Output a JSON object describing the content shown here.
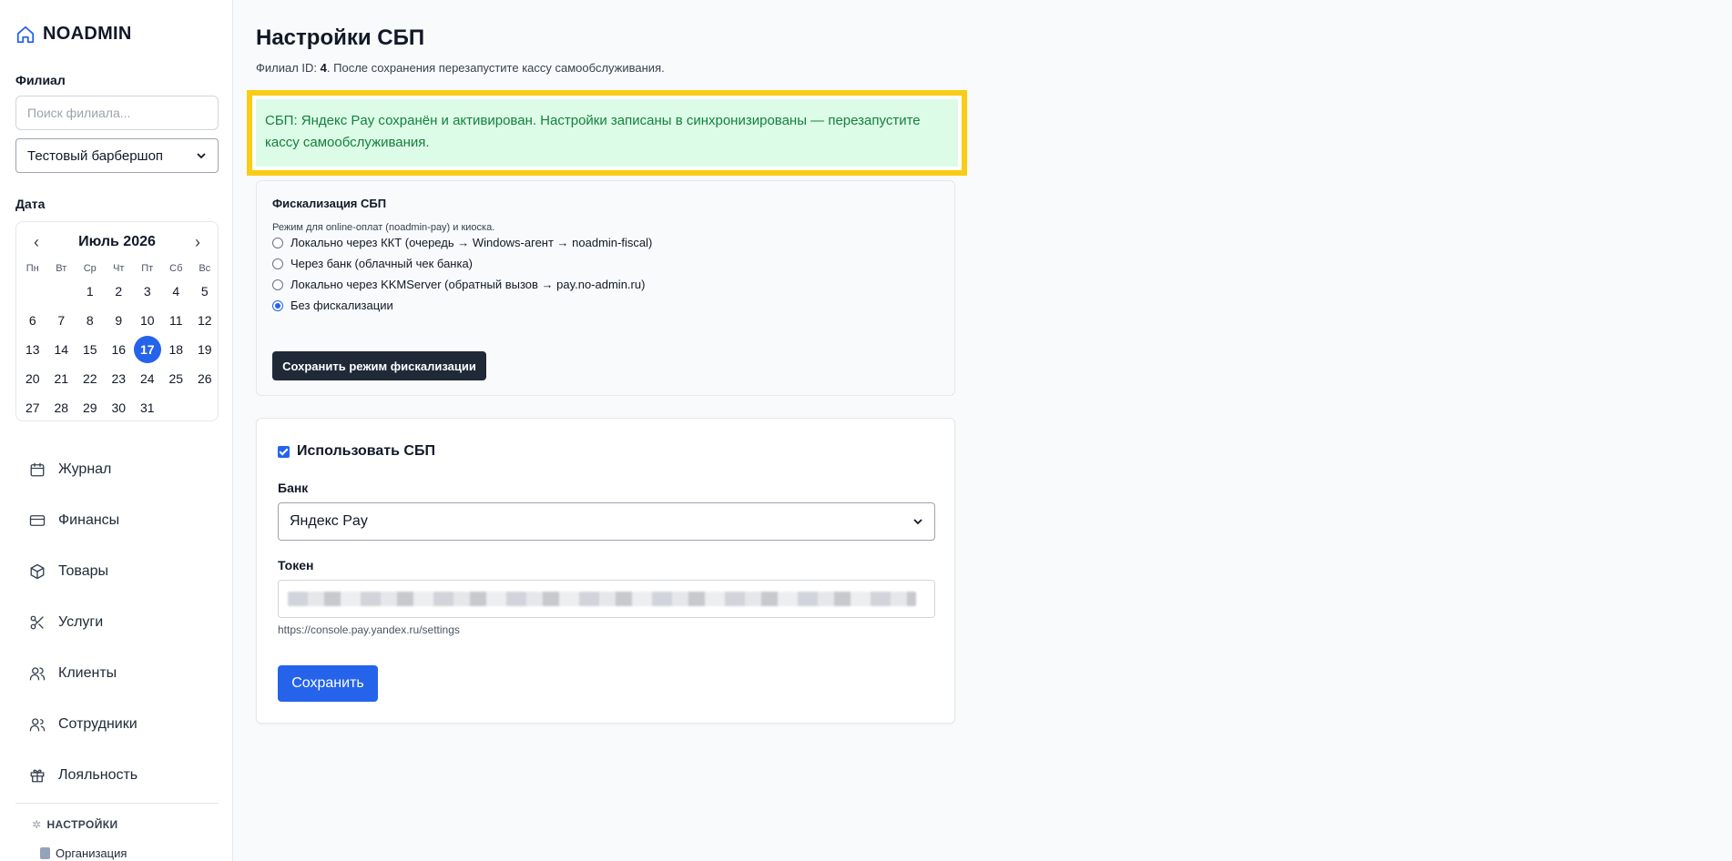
{
  "app": {
    "brand": "NOADMIN"
  },
  "sidebar": {
    "branch_label": "Филиал",
    "branch_search_placeholder": "Поиск филиала...",
    "branch_selected": "Тестовый барбершоп",
    "date_label": "Дата",
    "calendar": {
      "title": "Июль 2026",
      "weekdays": [
        "Пн",
        "Вт",
        "Ср",
        "Чт",
        "Пт",
        "Сб",
        "Вс"
      ],
      "leading_blanks": 2,
      "days_in_month": 31,
      "selected_day": 17
    },
    "nav": [
      {
        "label": "Журнал",
        "icon": "calendar-icon"
      },
      {
        "label": "Финансы",
        "icon": "credit-card-icon"
      },
      {
        "label": "Товары",
        "icon": "box-icon"
      },
      {
        "label": "Услуги",
        "icon": "scissors-icon"
      },
      {
        "label": "Клиенты",
        "icon": "users-icon"
      },
      {
        "label": "Сотрудники",
        "icon": "staff-icon"
      },
      {
        "label": "Лояльность",
        "icon": "gift-icon"
      }
    ],
    "settings_header": "НАСТРОЙКИ",
    "settings_items": [
      "Организация"
    ]
  },
  "main": {
    "title": "Настройки СБП",
    "subtitle_prefix": "Филиал ID: ",
    "branch_id": "4",
    "subtitle_suffix": ". После сохранения перезапустите кассу самообслуживания.",
    "alert": "СБП: Яндекс Pay сохранён и активирован. Настройки записаны в синхронизированы — перезапустите кассу самообслуживания.",
    "fiscal": {
      "title": "Фискализация СБП",
      "hint": "Режим для online-оплат (noadmin-pay) и киоска.",
      "options": [
        "Локально через ККТ (очередь → Windows-агент → noadmin-fiscal)",
        "Через банк (облачный чек банка)",
        "Локально через KKMServer (обратный вызов → pay.no-admin.ru)",
        "Без фискализации"
      ],
      "selected_index": 3,
      "save_label": "Сохранить режим фискализации"
    },
    "sbp": {
      "use_label": "Использовать СБП",
      "use_checked": true,
      "bank_label": "Банк",
      "bank_value": "Яндекс Pay",
      "token_label": "Токен",
      "token_hint": "https://console.pay.yandex.ru/settings",
      "save_label": "Сохранить"
    }
  },
  "colors": {
    "accent": "#2563eb",
    "alert_bg": "#dcfce7",
    "alert_text": "#15803d",
    "highlight": "#facc15"
  }
}
